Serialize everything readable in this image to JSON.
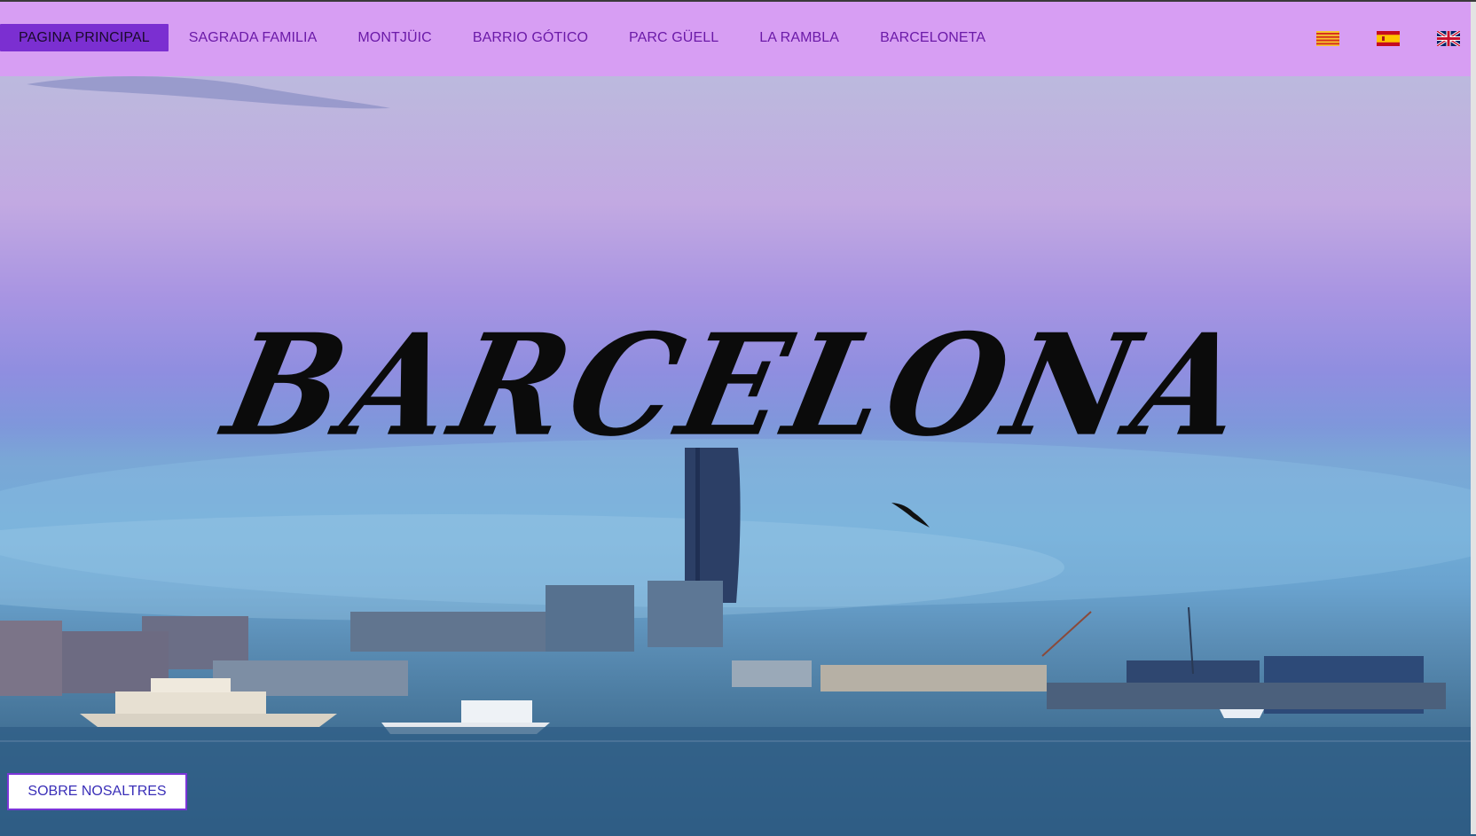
{
  "nav": {
    "items": [
      {
        "label": "PAGINA PRINCIPAL",
        "active": true
      },
      {
        "label": "SAGRADA FAMILIA",
        "active": false
      },
      {
        "label": "MONTJÜIC",
        "active": false
      },
      {
        "label": "BARRIO GÓTICO",
        "active": false
      },
      {
        "label": "PARC GÜELL",
        "active": false
      },
      {
        "label": "LA RAMBLA",
        "active": false
      },
      {
        "label": "BARCELONETA",
        "active": false
      }
    ]
  },
  "languages": [
    {
      "icon": "catalan-flag-icon"
    },
    {
      "icon": "spanish-flag-icon"
    },
    {
      "icon": "uk-flag-icon"
    }
  ],
  "hero": {
    "title": "BARCELONA"
  },
  "footer": {
    "about_label": "SOBRE NOSALTRES"
  },
  "colors": {
    "nav_bg": "#d79ef3",
    "nav_active_bg": "#7b2fd1",
    "nav_text": "#6b1aa8",
    "button_border": "#7b35d8"
  }
}
